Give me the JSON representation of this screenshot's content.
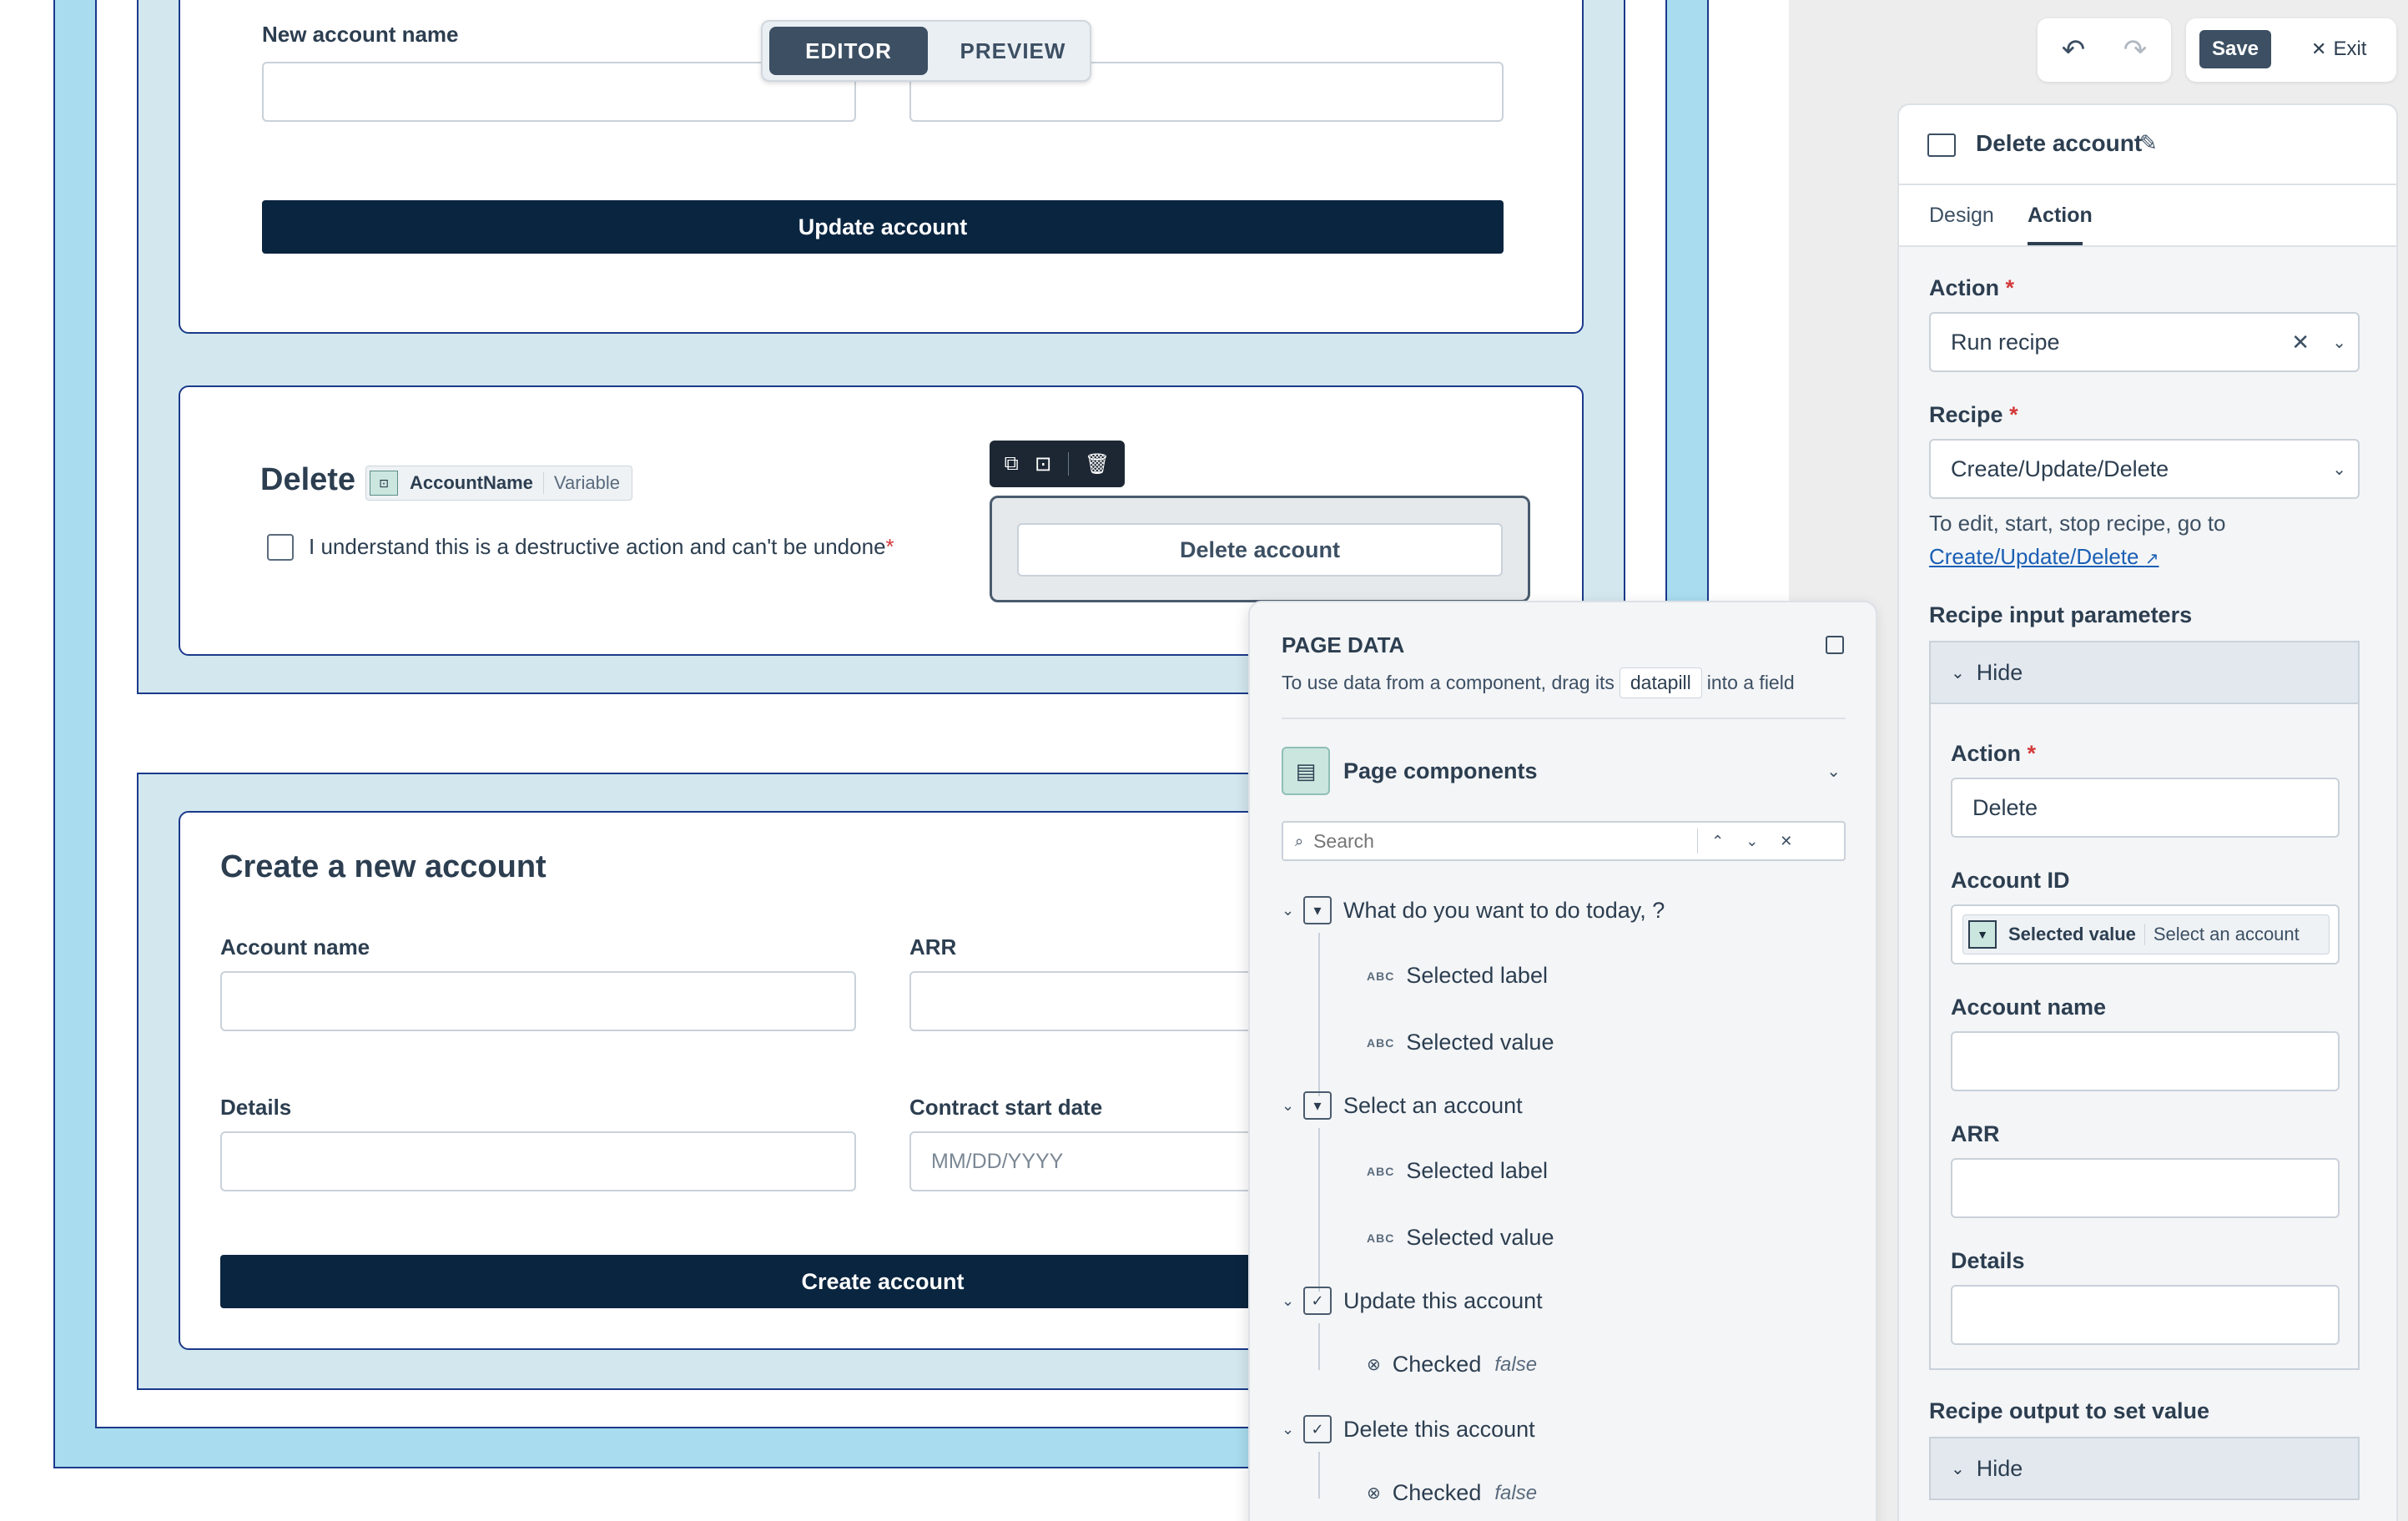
{
  "mode_toggle": {
    "editor": "EDITOR",
    "preview": "PREVIEW"
  },
  "toolbar": {
    "save": "Save",
    "exit": "Exit"
  },
  "update_form": {
    "new_name_label": "New account name",
    "update_button": "Update account"
  },
  "delete_form": {
    "title": "Delete",
    "pill_name": "AccountName",
    "pill_type": "Variable",
    "checkbox_label": "I understand this is a destructive action and can't be undone",
    "delete_button": "Delete account"
  },
  "create_form": {
    "title": "Create a new account",
    "account_name_label": "Account name",
    "arr_label": "ARR",
    "details_label": "Details",
    "contract_label": "Contract start date",
    "contract_placeholder": "MM/DD/YYYY",
    "create_button": "Create account"
  },
  "page_data": {
    "title": "PAGE DATA",
    "hint_before": "To use data from a component, drag its",
    "hint_pill": "datapill",
    "hint_after": "into a field",
    "section": "Page components",
    "search_placeholder": "Search",
    "tree": [
      {
        "label": "What do you want to do today, ?",
        "children": [
          {
            "type": "ABC",
            "label": "Selected label"
          },
          {
            "type": "ABC",
            "label": "Selected value"
          }
        ]
      },
      {
        "label": "Select an account",
        "children": [
          {
            "type": "ABC",
            "label": "Selected label"
          },
          {
            "type": "ABC",
            "label": "Selected value"
          }
        ]
      },
      {
        "label": "Update this account",
        "children": [
          {
            "type": "bool",
            "label": "Checked",
            "value": "false"
          }
        ]
      },
      {
        "label": "Delete this account",
        "children": [
          {
            "type": "bool",
            "label": "Checked",
            "value": "false"
          }
        ]
      }
    ]
  },
  "props_panel": {
    "title": "Delete account",
    "tabs": [
      "Design",
      "Action"
    ],
    "active_tab": "Action",
    "action_label": "Action",
    "action_value": "Run recipe",
    "recipe_label": "Recipe",
    "recipe_value": "Create/Update/Delete",
    "recipe_hint": "To edit, start, stop recipe, go to",
    "recipe_link": "Create/Update/Delete",
    "input_params_label": "Recipe input parameters",
    "hide_label": "Hide",
    "param_action_label": "Action",
    "param_action_value": "Delete",
    "account_id_label": "Account ID",
    "account_id_pill_name": "Selected value",
    "account_id_pill_source": "Select an account",
    "account_name_label": "Account name",
    "arr_label": "ARR",
    "details_label": "Details",
    "output_label": "Recipe output to set value",
    "output_hide_label": "Hide"
  },
  "colors": {
    "primary_dark": "#0a2540",
    "frame_blue": "#a8dcee",
    "section_blue": "#d3e7ef",
    "required": "#d43a3a",
    "link": "#1a5fb4"
  }
}
